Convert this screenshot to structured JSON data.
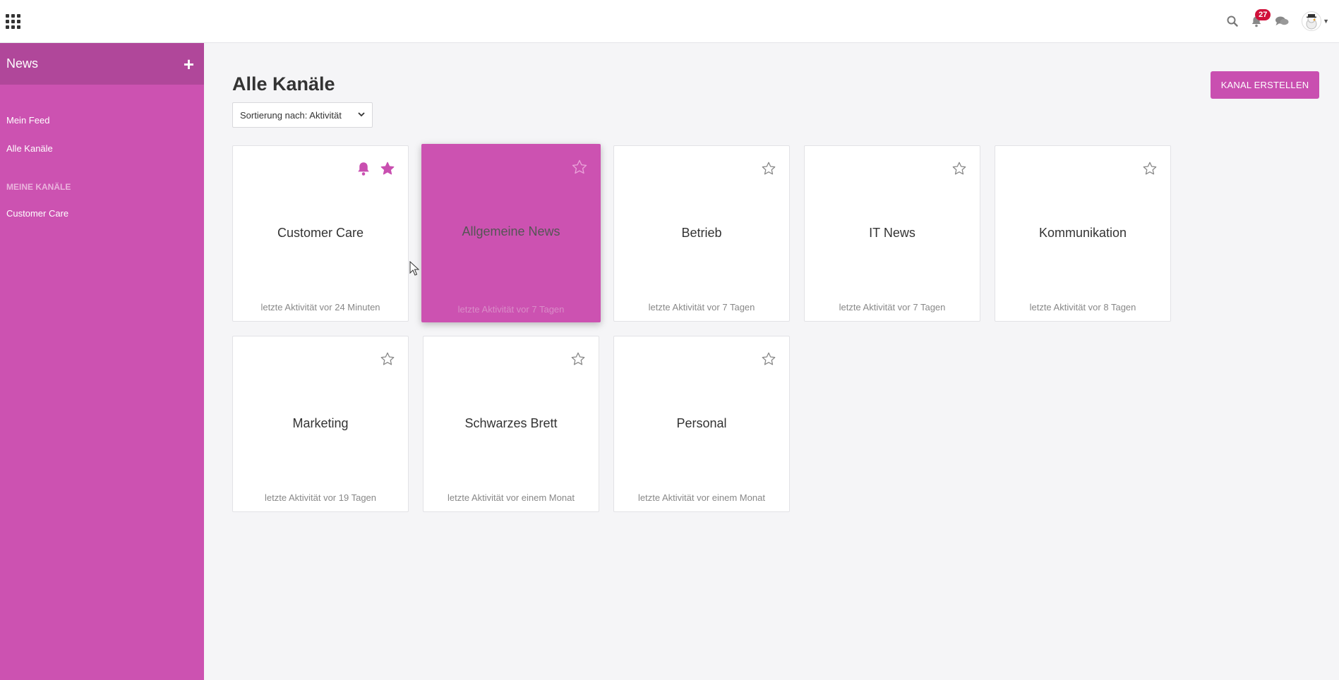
{
  "topbar": {
    "notifications_count": "27"
  },
  "sidebar": {
    "title": "News",
    "items": [
      {
        "label": "Mein Feed"
      },
      {
        "label": "Alle Kanäle"
      }
    ],
    "section_title": "MEINE KANÄLE",
    "my_channels": [
      {
        "label": "Customer Care"
      }
    ]
  },
  "main": {
    "title": "Alle Kanäle",
    "sort_label": "Sortierung nach: Aktivität",
    "create_button": "KANAL ERSTELLEN"
  },
  "colors": {
    "accent": "#cc52b1",
    "sidebar_header": "#b0479a",
    "badge": "#d0103a"
  },
  "cards": [
    {
      "name": "Customer Care",
      "activity": "letzte Aktivität vor 24 Minuten",
      "starred": true,
      "bell": true,
      "active": false
    },
    {
      "name": "Allgemeine News",
      "activity": "letzte Aktivität vor 7 Tagen",
      "starred": false,
      "bell": false,
      "active": true
    },
    {
      "name": "Betrieb",
      "activity": "letzte Aktivität vor 7 Tagen",
      "starred": false,
      "bell": false,
      "active": false
    },
    {
      "name": "IT News",
      "activity": "letzte Aktivität vor 7 Tagen",
      "starred": false,
      "bell": false,
      "active": false
    },
    {
      "name": "Kommunikation",
      "activity": "letzte Aktivität vor 8 Tagen",
      "starred": false,
      "bell": false,
      "active": false
    },
    {
      "name": "Marketing",
      "activity": "letzte Aktivität vor 19 Tagen",
      "starred": false,
      "bell": false,
      "active": false
    },
    {
      "name": "Schwarzes Brett",
      "activity": "letzte Aktivität vor einem Monat",
      "starred": false,
      "bell": false,
      "active": false
    },
    {
      "name": "Personal",
      "activity": "letzte Aktivität vor einem Monat",
      "starred": false,
      "bell": false,
      "active": false
    }
  ]
}
